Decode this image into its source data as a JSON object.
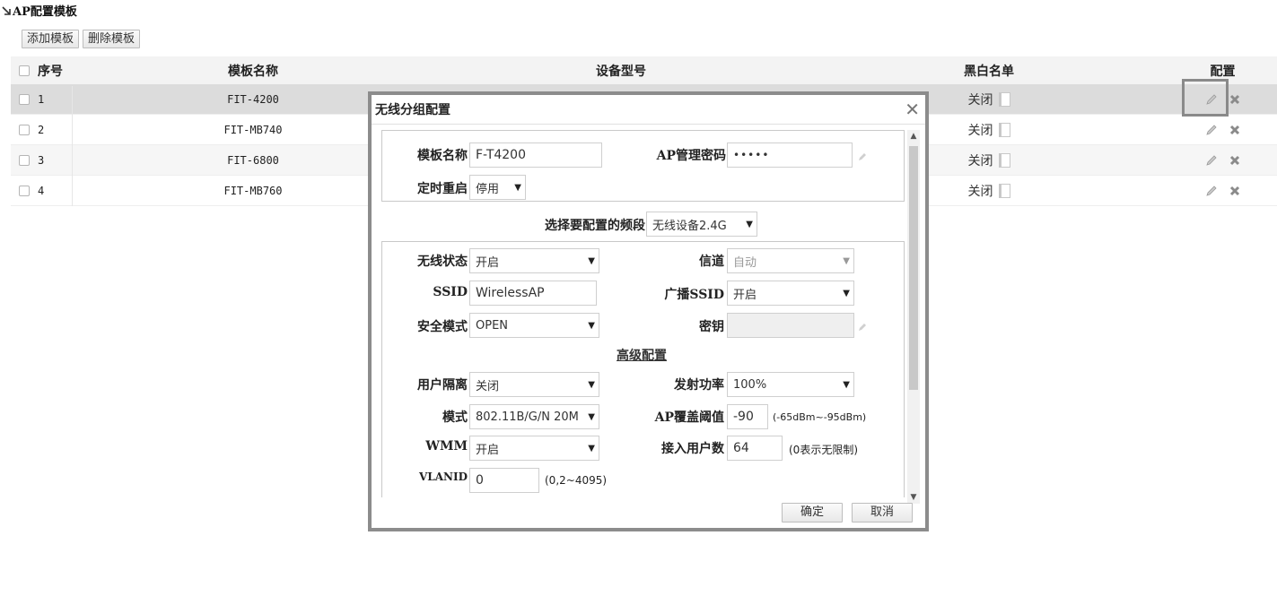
{
  "page": {
    "title": "AP配置模板"
  },
  "toolbar": {
    "add_label": "添加模板",
    "delete_label": "删除模板"
  },
  "grid": {
    "headers": {
      "no": "序号",
      "name": "模板名称",
      "model": "设备型号",
      "bw": "黑白名单",
      "config": "配置"
    },
    "rows": [
      {
        "no": "1",
        "name": "FIT-4200",
        "model": "",
        "bw": "关闭"
      },
      {
        "no": "2",
        "name": "FIT-MB740",
        "model": "",
        "bw": "关闭"
      },
      {
        "no": "3",
        "name": "FIT-6800",
        "model": "",
        "bw": "关闭"
      },
      {
        "no": "4",
        "name": "FIT-MB760",
        "model": "",
        "bw": "关闭"
      }
    ]
  },
  "dialog": {
    "title": "无线分组配置",
    "close_icon": "close-icon",
    "template_name_label": "模板名称",
    "template_name_value": "F-T4200",
    "ap_password_label": "AP管理密码",
    "ap_password_value": "•••••",
    "timed_reboot_label": "定时重启",
    "timed_reboot_value": "停用",
    "band_label": "选择要配置的频段",
    "band_value": "无线设备2.4G",
    "wireless_state_label": "无线状态",
    "wireless_state_value": "开启",
    "channel_label": "信道",
    "channel_value": "自动",
    "ssid_label": "SSID",
    "ssid_value": "WirelessAP",
    "broadcast_ssid_label": "广播SSID",
    "broadcast_ssid_value": "开启",
    "security_mode_label": "安全模式",
    "security_mode_value": "OPEN",
    "key_label": "密钥",
    "key_value": "",
    "advanced_label": "高级配置",
    "isolation_label": "用户隔离",
    "isolation_value": "关闭",
    "tx_power_label": "发射功率",
    "tx_power_value": "100%",
    "mode_label": "模式",
    "mode_value": "802.11B/G/N 20M",
    "coverage_label": "AP覆盖阈值",
    "coverage_value": "-90",
    "coverage_hint": "(-65dBm~-95dBm)",
    "wmm_label": "WMM",
    "wmm_value": "开启",
    "max_users_label": "接入用户数",
    "max_users_value": "64",
    "max_users_hint": "(0表示无限制)",
    "vlanid_label": "VLANID",
    "vlanid_value": "0",
    "vlanid_hint": "(0,2~4095)",
    "ok_label": "确定",
    "cancel_label": "取消"
  }
}
